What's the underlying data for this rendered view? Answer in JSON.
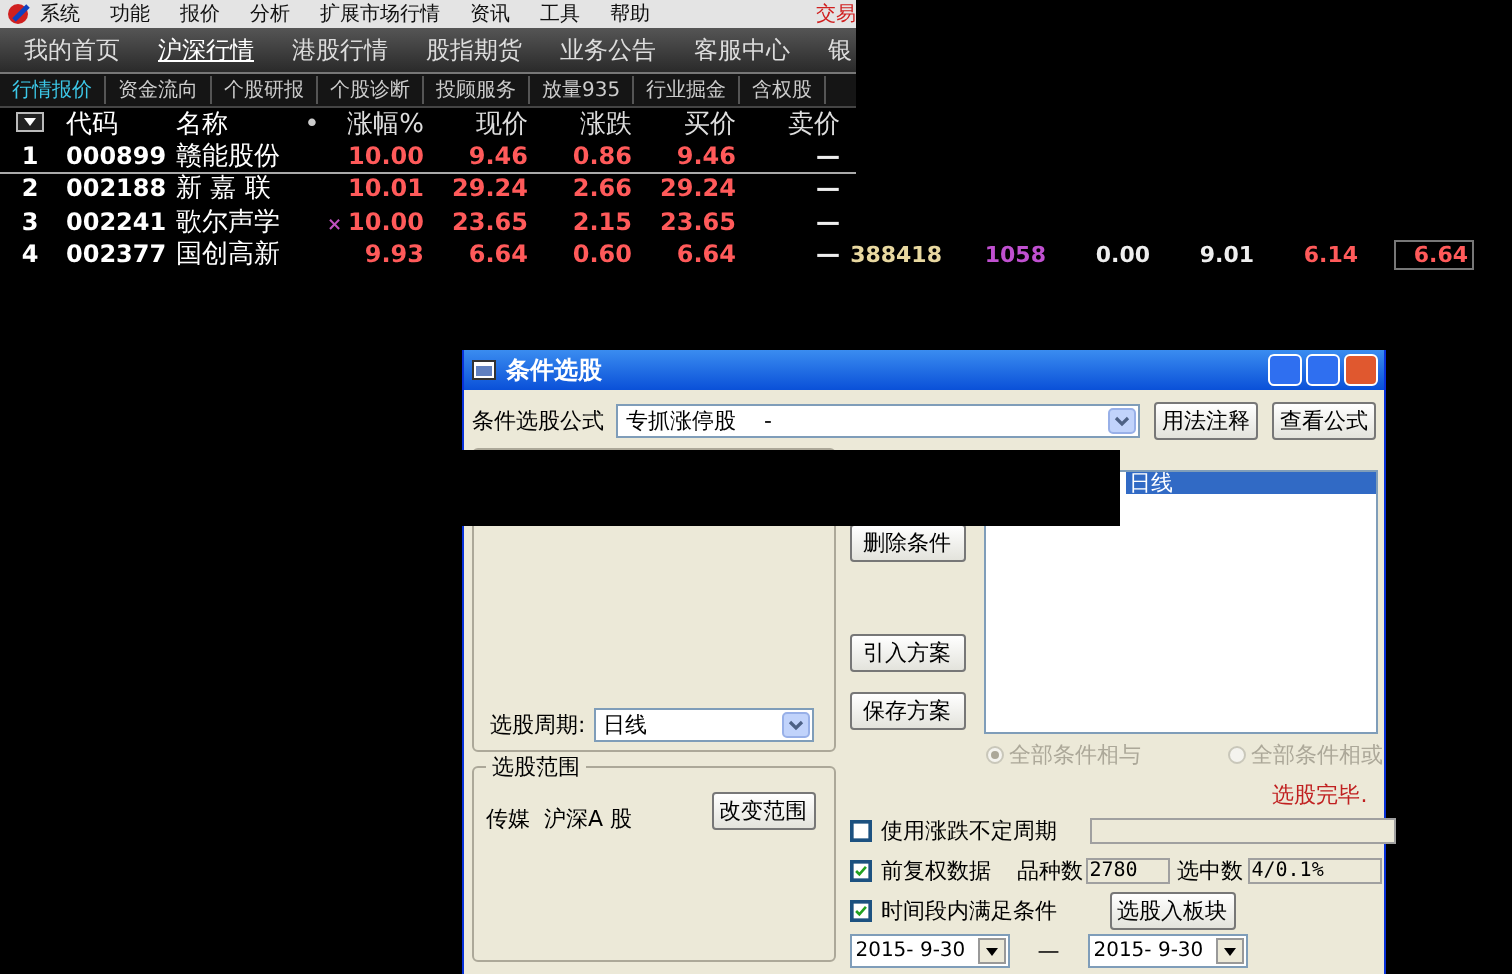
{
  "menu": {
    "items": [
      "系统",
      "功能",
      "报价",
      "分析",
      "扩展市场行情",
      "资讯",
      "工具",
      "帮助"
    ],
    "trade": "交易"
  },
  "tabs": [
    {
      "label": "我的首页",
      "selected": false
    },
    {
      "label": "沪深行情",
      "selected": true
    },
    {
      "label": "港股行情",
      "selected": false
    },
    {
      "label": "股指期货",
      "selected": false
    },
    {
      "label": "业务公告",
      "selected": false
    },
    {
      "label": "客服中心",
      "selected": false
    },
    {
      "label": "银",
      "selected": false
    }
  ],
  "subtabs": [
    {
      "label": "行情报价",
      "selected": true
    },
    {
      "label": "资金流向",
      "selected": false
    },
    {
      "label": "个股研报",
      "selected": false
    },
    {
      "label": "个股诊断",
      "selected": false
    },
    {
      "label": "投顾服务",
      "selected": false
    },
    {
      "label": "放量935",
      "selected": false
    },
    {
      "label": "行业掘金",
      "selected": false
    },
    {
      "label": "含权股",
      "selected": false
    }
  ],
  "quote_table": {
    "columns": [
      "代码",
      "名称",
      "•",
      "涨幅%",
      "现价",
      "涨跌",
      "买价",
      "卖价"
    ],
    "rows": [
      {
        "index": "1",
        "code": "000899",
        "name": "赣能股份",
        "selected": true,
        "values": [
          "10.00",
          "9.46",
          "0.86",
          "9.46",
          "—"
        ]
      },
      {
        "index": "2",
        "code": "002188",
        "name": "新 嘉 联",
        "selected": false,
        "values": [
          "10.01",
          "29.24",
          "2.66",
          "29.24",
          "—"
        ]
      },
      {
        "index": "3",
        "code": "002241",
        "name": "歌尔声学",
        "mark": "×",
        "selected": false,
        "values": [
          "10.00",
          "23.65",
          "2.15",
          "23.65",
          "—"
        ]
      },
      {
        "index": "4",
        "code": "002377",
        "name": "国创高新",
        "selected": false,
        "values": [
          "9.93",
          "6.64",
          "0.60",
          "6.64",
          "—"
        ],
        "extra": [
          {
            "text": "388418",
            "kind": "volume"
          },
          {
            "text": "1058",
            "kind": "count"
          },
          {
            "text": "0.00",
            "kind": "flat"
          },
          {
            "text": "9.01",
            "kind": "flat"
          },
          {
            "text": "6.14",
            "kind": "up"
          },
          {
            "text": "6.64",
            "kind": "boxed"
          }
        ]
      }
    ]
  },
  "dialog": {
    "title": "条件选股",
    "formula": {
      "label": "条件选股公式",
      "value": "专抓涨停股    -"
    },
    "buttons": [
      "用法注释",
      "查看公式"
    ],
    "period": {
      "label": "选股周期:",
      "value": "日线"
    },
    "action_buttons": [
      "删除条件",
      "引入方案",
      "保存方案"
    ],
    "conditions": [
      {
        "label": "日线",
        "selected": true
      }
    ],
    "combine_disabled": true,
    "combine": [
      {
        "label": "全部条件相与",
        "selected": true
      },
      {
        "label": "全部条件相或",
        "selected": false
      }
    ],
    "scope": {
      "title": "选股范围",
      "text": "传媒  沪深A 股",
      "button": "改变范围"
    },
    "status": "选股完毕.",
    "options": [
      {
        "label": "使用涨跌不定周期",
        "checked": false
      },
      {
        "label": "前复权数据",
        "checked": true
      },
      {
        "label": "时间段内满足条件",
        "checked": true
      }
    ],
    "variety": {
      "label": "品种数",
      "value": "2780"
    },
    "picked": {
      "label": "选中数",
      "value": "4/0.1%"
    },
    "board_button": "选股入板块",
    "date_from": "2015- 9-30",
    "date_sep": "—",
    "date_to": "2015- 9-30"
  }
}
